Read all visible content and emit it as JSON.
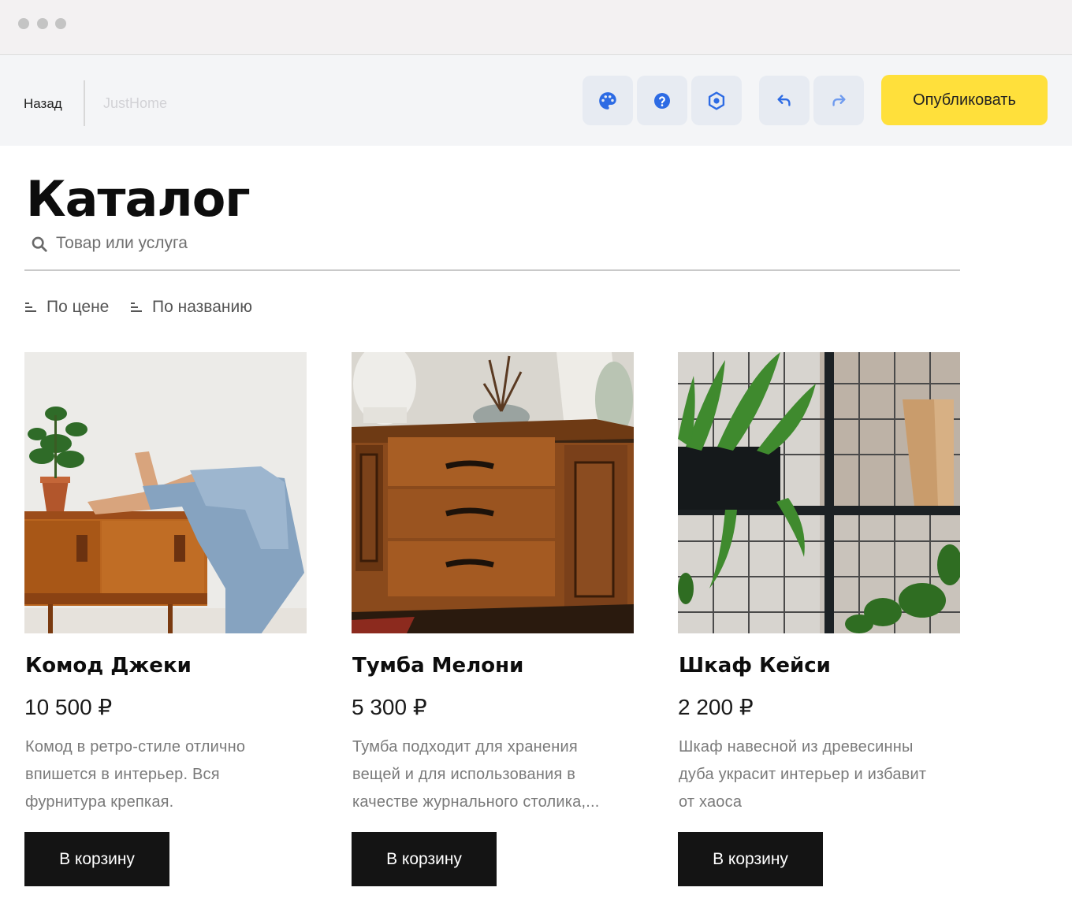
{
  "toolbar": {
    "back_label": "Назад",
    "site_name": "JustHome",
    "publish_label": "Опубликовать",
    "accent_color": "#ffe03b",
    "icon_color": "#2d6be4",
    "icons": [
      "palette-icon",
      "help-icon",
      "settings-hex-icon",
      "undo-icon",
      "redo-icon"
    ]
  },
  "catalog": {
    "title": "Каталог",
    "search_placeholder": "Товар или услуга",
    "sort_price": "По цене",
    "sort_name": "По названию"
  },
  "products": [
    {
      "title": "Комод Джеки",
      "price": "10 500 ₽",
      "desc_lines": [
        "Комод в ретро-стиле отлично",
        "впишется в интерьер. Вся",
        "фурнитура крепкая."
      ],
      "button": "В корзину"
    },
    {
      "title": "Тумба Мелони",
      "price": "5 300 ₽",
      "desc_lines": [
        "Тумба подходит для хранения",
        "вещей и для использования в",
        "качестве журнального столика,..."
      ],
      "button": "В корзину"
    },
    {
      "title": "Шкаф Кейси",
      "price": "2 200 ₽",
      "desc_lines": [
        "Шкаф навесной из древесинны",
        "дуба украсит интерьер и избавит",
        "от хаоса"
      ],
      "button": "В корзину"
    }
  ]
}
